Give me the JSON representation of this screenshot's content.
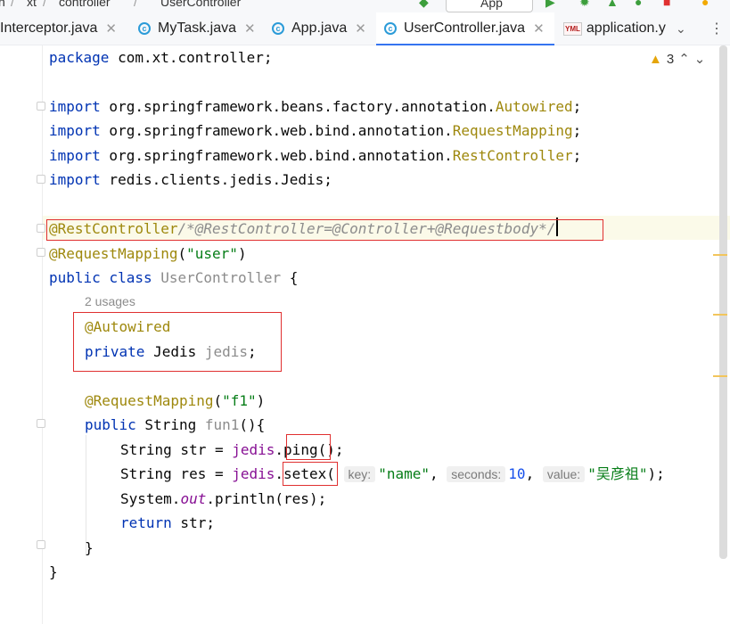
{
  "breadcrumb": {
    "item1": "xt",
    "item2": "controller",
    "item3": "UserController",
    "run_config": "App"
  },
  "tabs": [
    {
      "label": "Interceptor.java",
      "icon": "class-icon"
    },
    {
      "label": "MyTask.java",
      "icon": "class-icon"
    },
    {
      "label": "App.java",
      "icon": "run-class-icon"
    },
    {
      "label": "UserController.java",
      "icon": "class-icon",
      "active": true
    },
    {
      "label": "application.y",
      "icon": "yml-icon"
    }
  ],
  "yml_icon_text": "YML",
  "warnings": {
    "count": "3"
  },
  "code": {
    "package_kw": "package",
    "package_name": " com.xt.controller;",
    "import_kw": "import",
    "imp1_path": " org.springframework.beans.factory.annotation.",
    "imp1_cls": "Autowired",
    "imp1_semi": ";",
    "imp2_path": " org.springframework.web.bind.annotation.",
    "imp2_cls": "RequestMapping",
    "imp2_semi": ";",
    "imp3_path": " org.springframework.web.bind.annotation.",
    "imp3_cls": "RestController",
    "imp3_semi": ";",
    "imp4_path": " redis.clients.jedis.Jedis;",
    "restcontroller": "@RestController",
    "comment": "/*@RestController=@Controller+@Requestbody*/",
    "requestmapping": "@RequestMapping",
    "rm_open": "(",
    "rm_value": "\"user\"",
    "rm_close": ")",
    "public_kw": "public",
    "class_kw": "class",
    "class_name": "UserController",
    "open_brace": " {",
    "usages": "2 usages",
    "autowired": "@Autowired",
    "private_kw": "private",
    "jedis_type": " Jedis ",
    "jedis_field": "jedis",
    "semicolon": ";",
    "rm2": "@RequestMapping",
    "rm2_open": "(",
    "rm2_value": "\"f1\"",
    "rm2_close": ")",
    "public2_kw": "public",
    "fun_sig": " String ",
    "fun_name": "fun1",
    "fun_rest": "(){",
    "l1_a": "String str = ",
    "l1_obj": "jedis",
    "l1_dot": ".",
    "l1_method": "ping",
    "l1_end": "();",
    "l2_a": "String res = ",
    "l2_obj": "jedis",
    "l2_dot": ".",
    "l2_method": "setex",
    "l2_paren": "(",
    "hint_key": "key:",
    "arg_key": "\"name\"",
    "comma": ", ",
    "hint_seconds": "seconds:",
    "arg_seconds": "10",
    "comma2": ", ",
    "hint_value": "value:",
    "arg_value": "\"吴彦祖\"",
    "l2_end": ");",
    "l3_a": "System.",
    "l3_out": "out",
    "l3_b": ".println(res);",
    "return_kw": "return",
    "return_rest": " str;",
    "close_inner": "}",
    "close_outer": "}"
  }
}
